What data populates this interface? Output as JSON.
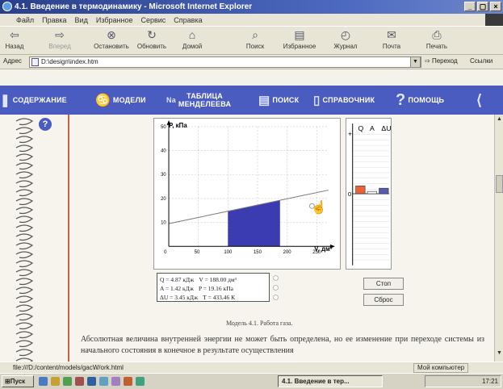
{
  "window": {
    "title": "4.1. Введение в термодинамику - Microsoft Internet Explorer",
    "buttons": [
      "_",
      "▢",
      "×"
    ]
  },
  "menu": {
    "items": [
      "Файл",
      "Правка",
      "Вид",
      "Избранное",
      "Сервис",
      "Справка"
    ]
  },
  "toolbar": {
    "back": "Назад",
    "forward": "Вперед",
    "stop": "Остановить",
    "refresh": "Обновить",
    "home": "Домой",
    "search": "Поиск",
    "favorites": "Избранное",
    "history": "Журнал",
    "mail": "Почта",
    "print": "Печать"
  },
  "address": {
    "label": "Адрес",
    "value": "D:\\design\\index.htm",
    "go": "Переход",
    "links": "Ссылки"
  },
  "sitenav": {
    "contents": "СОДЕРЖАНИЕ",
    "models": "МОДЕЛИ",
    "table_line1": "ТАБЛИЦА",
    "table_line2": "МЕНДЕЛЕЕВА",
    "search": "ПОИСК",
    "reference": "СПРАВОЧНИК",
    "help": "ПОМОЩЬ"
  },
  "chart_data": {
    "type": "line",
    "ylabel": "P, кПа",
    "xlabel": "V, дм³",
    "xlim": [
      0,
      270
    ],
    "ylim": [
      0,
      50
    ],
    "xticks": [
      0,
      50,
      100,
      150,
      200,
      250
    ],
    "yticks": [
      10,
      20,
      30,
      40,
      50
    ],
    "x_tick_labels": [
      "50",
      "100",
      "150",
      "200",
      "250"
    ],
    "y_tick_labels": [
      "10",
      "20",
      "30",
      "40",
      "50"
    ],
    "series": [
      {
        "type": "line",
        "points": [
          [
            0,
            9.5
          ],
          [
            270,
            23.5
          ]
        ]
      },
      {
        "type": "area",
        "x": [
          100,
          188
        ],
        "y_bottom": 0,
        "top_points": [
          [
            100,
            14.6
          ],
          [
            188,
            19.2
          ]
        ]
      }
    ],
    "grid": true
  },
  "bars": {
    "labels": [
      "Q",
      "A",
      "ΔU"
    ],
    "values": [
      4.87,
      1.42,
      3.45
    ],
    "colors": [
      "#e8623a",
      "#ffffff",
      "#5a5ab0"
    ],
    "plus_label": "+",
    "zero_label": "0"
  },
  "info": {
    "q": "Q = 4.87 кДж",
    "v": "V = 188.00 дм³",
    "a": "A = 1.42 кДж",
    "p": "P = 19.16 кПа",
    "du": "ΔU = 3.45 кДж",
    "t": "T = 433.46 К"
  },
  "controls": {
    "stop": "Стоп",
    "reset": "Сброс"
  },
  "caption": "Модель 4.1. Работа газа.",
  "body_text": "Абсолютная величина внутренней энергии не может быть определена, но ее изменение при переходе системы из начального состояния в конечное в результате осуществления",
  "status": {
    "url": "file:///D:/content/models/gacW/ork.html",
    "zone": "Мой компьютер"
  },
  "taskbar": {
    "start": "Пуск",
    "task": "4.1. Введение в тер...",
    "clock": "17:21"
  }
}
